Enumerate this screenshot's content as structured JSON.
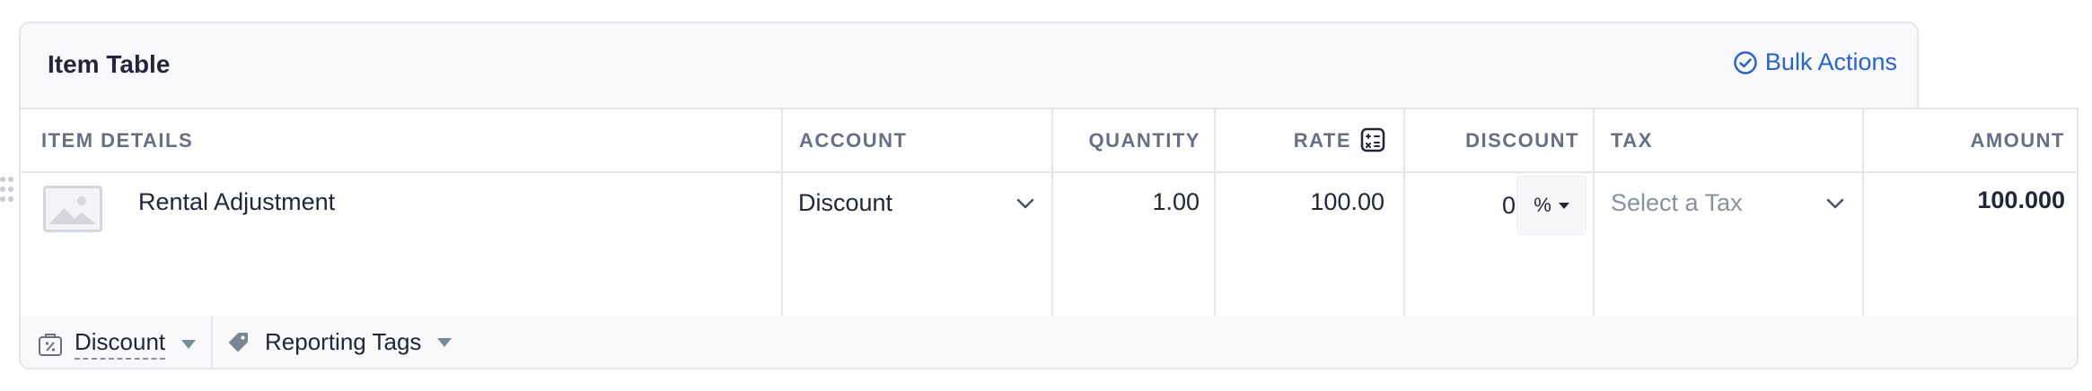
{
  "header": {
    "title": "Item Table",
    "bulk_actions_label": "Bulk Actions"
  },
  "columns": {
    "item_details": "ITEM DETAILS",
    "account": "ACCOUNT",
    "quantity": "QUANTITY",
    "rate": "RATE",
    "discount": "DISCOUNT",
    "tax": "TAX",
    "amount": "AMOUNT"
  },
  "row": {
    "item_name": "Rental Adjustment",
    "account_value": "Discount",
    "quantity": "1.00",
    "rate": "100.00",
    "discount_value": "0",
    "discount_unit": "%",
    "tax_placeholder": "Select a Tax",
    "amount": "100.000"
  },
  "footer": {
    "discount_label": "Discount",
    "reporting_tags_label": "Reporting Tags"
  },
  "colors": {
    "accent": "#2563d8",
    "border": "#e4e6ec",
    "header_bg": "#f9f9fb"
  },
  "icons": {
    "bulk_actions": "check-circle-icon",
    "rate": "calculator-icon",
    "discount_footer": "discount-tag-icon",
    "reporting_tags": "tag-icon",
    "image_placeholder": "image-icon",
    "drag": "drag-handle-icon"
  }
}
